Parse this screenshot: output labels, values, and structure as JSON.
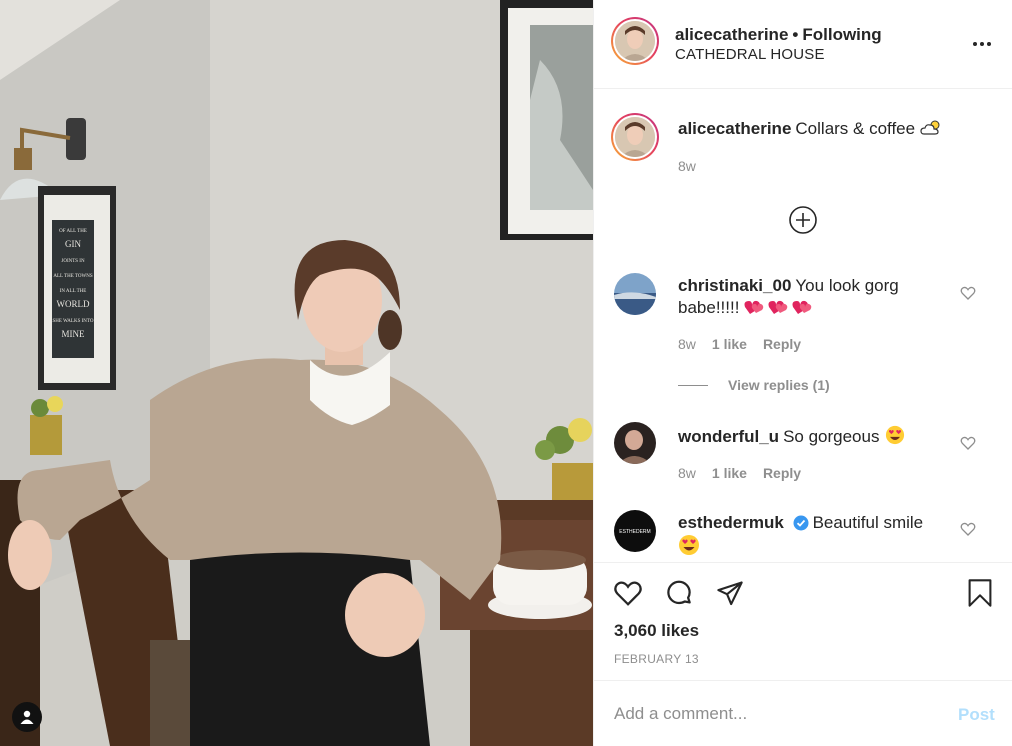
{
  "post": {
    "username": "alicecatherine",
    "separator": "•",
    "follow_status": "Following",
    "location": "CATHEDRAL HOUSE",
    "caption": "Collars & coffee",
    "caption_age": "8w"
  },
  "comments": [
    {
      "user": "christinaki_00",
      "text": "You look gorg babe!!!!!",
      "age": "8w",
      "likes": "1 like",
      "reply": "Reply"
    },
    {
      "user": "wonderful_u",
      "text": "So gorgeous",
      "age": "8w",
      "likes": "1 like",
      "reply": "Reply"
    },
    {
      "user": "esthedermuk",
      "text": "Beautiful smile"
    }
  ],
  "view_replies": "View replies (1)",
  "likes_count": "3,060 likes",
  "date": "FEBRUARY 13",
  "add_comment": {
    "placeholder": "Add a comment...",
    "post_label": "Post"
  },
  "photo": {
    "sign_lines": [
      "OF ALL THE",
      "GIN",
      "JOINTS IN",
      "ALL THE TOWNS",
      "IN ALL THE",
      "WORLD",
      "SHE WALKS INTO",
      "MINE"
    ],
    "badge_text": "INSTITUT ESTHEDERM"
  },
  "colors": {
    "accent_blue": "#0095f6",
    "post_disabled": "#b2dffc",
    "muted": "#8e8e8e",
    "verified": "#3897f0"
  },
  "icons": [
    "more-icon",
    "add-circle-icon",
    "heart-icon",
    "comment-icon",
    "share-icon",
    "bookmark-icon",
    "user-tag-icon",
    "verified-badge-icon",
    "cloud-sun-emoji",
    "heart-eyes-emoji",
    "two-hearts-emoji"
  ]
}
